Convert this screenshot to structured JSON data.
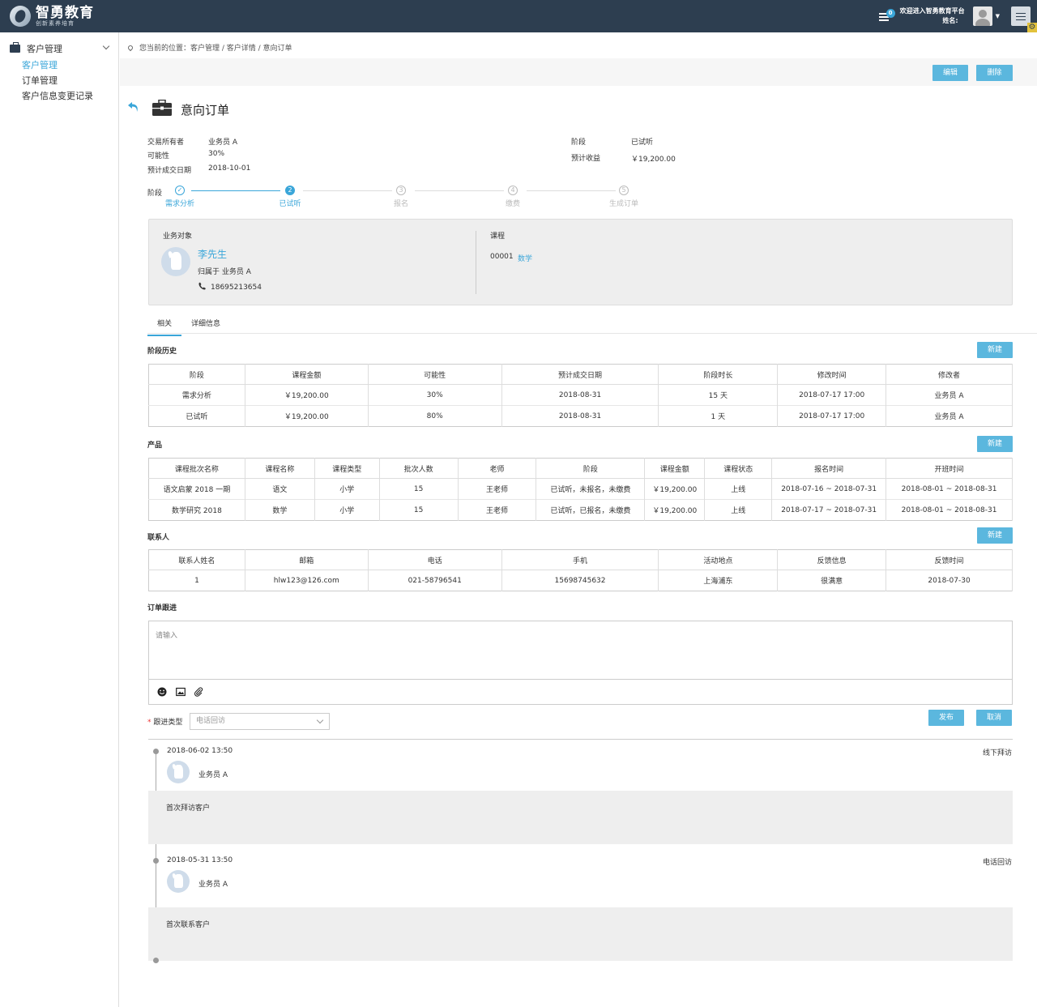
{
  "brand": {
    "name": "智勇教育",
    "slogan": "创新素养培育"
  },
  "header": {
    "badge_count": "0",
    "welcome": "欢迎进入智勇教育平台",
    "user_label": "姓名:"
  },
  "sidebar": {
    "group": "客户管理",
    "items": [
      {
        "label": "客户管理",
        "active": true
      },
      {
        "label": "订单管理",
        "active": false
      },
      {
        "label": "客户信息变更记录",
        "active": false
      }
    ]
  },
  "breadcrumb": "您当前的位置：客户管理 / 客户详情 / 意向订单",
  "toolbar": {
    "edit": "编辑",
    "delete": "删除"
  },
  "page_title": "意向订单",
  "info": {
    "owner_label": "交易所有者",
    "owner": "业务员 A",
    "prob_label": "可能性",
    "prob": "30%",
    "date_label": "预计成交日期",
    "date": "2018-10-01",
    "stage_label": "阶段",
    "stage": "已试听",
    "revenue_label": "预计收益",
    "revenue": "￥19,200.00"
  },
  "stepper": {
    "label": "阶段",
    "steps": [
      {
        "num": "✓",
        "label": "需求分析"
      },
      {
        "num": "2",
        "label": "已试听"
      },
      {
        "num": "3",
        "label": "报名"
      },
      {
        "num": "4",
        "label": "缴费"
      },
      {
        "num": "5",
        "label": "生成订单"
      }
    ]
  },
  "card": {
    "target_label": "业务对象",
    "customer_name": "李先生",
    "belongs": "归属于 业务员 A",
    "phone": "18695213654",
    "course_label": "课程",
    "course_code": "00001",
    "course_name": "数学"
  },
  "tabs": [
    "相关",
    "详细信息"
  ],
  "new_label": "新建",
  "stage_history": {
    "title": "阶段历史",
    "headers": [
      "阶段",
      "课程金额",
      "可能性",
      "预计成交日期",
      "阶段时长",
      "修改时间",
      "修改者"
    ],
    "rows": [
      [
        "需求分析",
        "￥19,200.00",
        "30%",
        "2018-08-31",
        "15 天",
        "2018-07-17  17:00",
        "业务员 A"
      ],
      [
        "已试听",
        "￥19,200.00",
        "80%",
        "2018-08-31",
        "1 天",
        "2018-07-17  17:00",
        "业务员 A"
      ]
    ]
  },
  "products": {
    "title": "产品",
    "headers": [
      "课程批次名称",
      "课程名称",
      "课程类型",
      "批次人数",
      "老师",
      "阶段",
      "课程金额",
      "课程状态",
      "报名时间",
      "开班时间"
    ],
    "rows": [
      [
        "语文启蒙 2018 一期",
        "语文",
        "小学",
        "15",
        "王老师",
        "已试听，未报名，未缴费",
        "￥19,200.00",
        "上线",
        "2018-07-16 ~ 2018-07-31",
        "2018-08-01 ~ 2018-08-31"
      ],
      [
        "数学研究 2018",
        "数学",
        "小学",
        "15",
        "王老师",
        "已试听，已报名，未缴费",
        "￥19,200.00",
        "上线",
        "2018-07-17 ~ 2018-07-31",
        "2018-08-01 ~ 2018-08-31"
      ]
    ]
  },
  "contacts": {
    "title": "联系人",
    "headers": [
      "联系人姓名",
      "邮箱",
      "电话",
      "手机",
      "活动地点",
      "反馈信息",
      "反馈时间"
    ],
    "rows": [
      [
        "1",
        "hlw123@126.com",
        "021-58796541",
        "15698745632",
        "上海浦东",
        "很满意",
        "2018-07-30"
      ]
    ]
  },
  "followup": {
    "title": "订单跟进",
    "placeholder": "请输入",
    "type_label": "跟进类型",
    "type_placeholder": "电话回访",
    "publish": "发布",
    "cancel": "取消"
  },
  "timeline": [
    {
      "time": "2018-06-02 13:50",
      "user": "业务员 A",
      "type": "线下拜访",
      "content": "首次拜访客户"
    },
    {
      "time": "2018-05-31 13:50",
      "user": "业务员 A",
      "type": "电话回访",
      "content": "首次联系客户"
    }
  ]
}
